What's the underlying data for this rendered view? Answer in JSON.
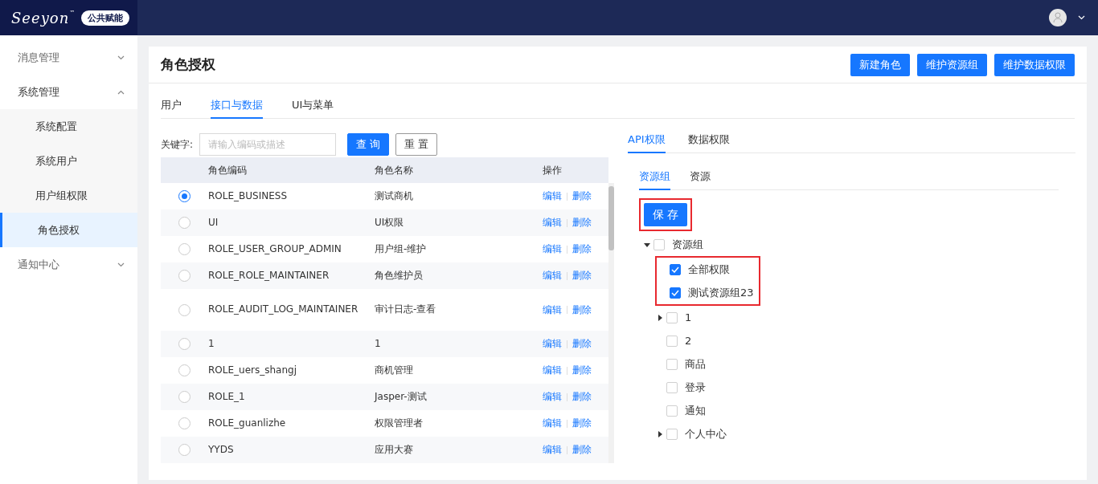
{
  "header": {
    "logo": "Seeyon",
    "logo_mark": "™",
    "badge": "公共赋能"
  },
  "sidebar": {
    "items": [
      {
        "label": "消息管理",
        "expanded": false,
        "selected": false
      },
      {
        "label": "系统管理",
        "expanded": true,
        "selected": false,
        "children": [
          {
            "label": "系统配置",
            "selected": false
          },
          {
            "label": "系统用户",
            "selected": false
          },
          {
            "label": "用户组权限",
            "selected": false
          },
          {
            "label": "角色授权",
            "selected": true
          }
        ]
      },
      {
        "label": "通知中心",
        "expanded": false,
        "selected": false
      }
    ]
  },
  "page": {
    "title": "角色授权",
    "actions": [
      "新建角色",
      "维护资源组",
      "维护数据权限"
    ]
  },
  "tabs": [
    {
      "label": "用户",
      "selected": false
    },
    {
      "label": "接口与数据",
      "selected": true
    },
    {
      "label": "UI与菜单",
      "selected": false
    }
  ],
  "search": {
    "label": "关键字:",
    "placeholder": "请输入编码或描述",
    "query_button": "查 询",
    "reset_button": "重 置"
  },
  "table": {
    "columns": [
      "角色编码",
      "角色名称",
      "操作"
    ],
    "rows": [
      {
        "code": "ROLE_BUSINESS",
        "name": "测试商机",
        "selected": true,
        "edit": "编辑",
        "delete": "删除"
      },
      {
        "code": "UI",
        "name": "UI权限",
        "selected": false,
        "edit": "编辑",
        "delete": "删除"
      },
      {
        "code": "ROLE_USER_GROUP_ADMIN",
        "name": "用户组-维护",
        "selected": false,
        "edit": "编辑",
        "delete": "删除"
      },
      {
        "code": "ROLE_ROLE_MAINTAINER",
        "name": "角色维护员",
        "selected": false,
        "edit": "编辑",
        "delete": "删除"
      },
      {
        "code": "ROLE_AUDIT_LOG_MAINTAINER",
        "name": "审计日志-查看",
        "selected": false,
        "edit": "编辑",
        "delete": "删除"
      },
      {
        "code": "1",
        "name": "1",
        "selected": false,
        "edit": "编辑",
        "delete": "删除"
      },
      {
        "code": "ROLE_uers_shangj",
        "name": "商机管理",
        "selected": false,
        "edit": "编辑",
        "delete": "删除"
      },
      {
        "code": "ROLE_1",
        "name": "Jasper-测试",
        "selected": false,
        "edit": "编辑",
        "delete": "删除"
      },
      {
        "code": "ROLE_guanlizhe",
        "name": "权限管理者",
        "selected": false,
        "edit": "编辑",
        "delete": "删除"
      },
      {
        "code": "YYDS",
        "name": "应用大赛",
        "selected": false,
        "edit": "编辑",
        "delete": "删除"
      }
    ]
  },
  "permission_tabs": [
    {
      "label": "API权限",
      "selected": true
    },
    {
      "label": "数据权限",
      "selected": false
    }
  ],
  "resource_tabs": [
    {
      "label": "资源组",
      "selected": true
    },
    {
      "label": "资源",
      "selected": false
    }
  ],
  "save_button": {
    "label": "保 存",
    "highlighted": true
  },
  "tree": [
    {
      "label": "资源组",
      "checked": false,
      "expanded": true,
      "children": [
        {
          "label": "全部权限",
          "checked": true,
          "highlighted": true
        },
        {
          "label": "测试资源组23",
          "checked": true,
          "highlighted": true
        },
        {
          "label": "1",
          "checked": false,
          "expanded": false
        },
        {
          "label": "2",
          "checked": false
        },
        {
          "label": "商品",
          "checked": false
        },
        {
          "label": "登录",
          "checked": false
        },
        {
          "label": "通知",
          "checked": false
        },
        {
          "label": "个人中心",
          "checked": false,
          "expanded": false
        }
      ]
    }
  ]
}
